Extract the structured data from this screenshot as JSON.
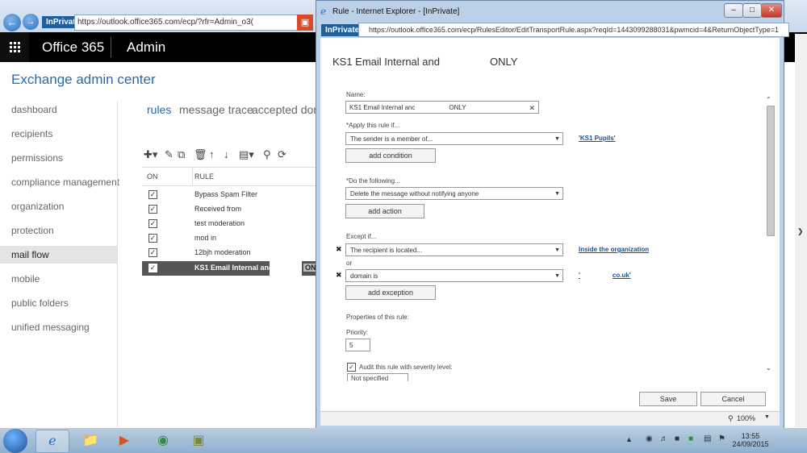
{
  "browser": {
    "inprivate": "InPrivate",
    "url": "https://outlook.office365.com/ecp/?rfr=Admin_o3("
  },
  "o365": {
    "brand": "Office 365",
    "section": "Admin"
  },
  "eac_title": "Exchange admin center",
  "nav": [
    "dashboard",
    "recipients",
    "permissions",
    "compliance management",
    "organization",
    "protection",
    "mail flow",
    "mobile",
    "public folders",
    "unified messaging"
  ],
  "tabs": [
    "rules",
    "message trace",
    "accepted dom"
  ],
  "table": {
    "headers": [
      "ON",
      "RULE"
    ],
    "rows": [
      "Bypass Spam Filter",
      "Received from",
      "test moderation",
      "mod in",
      "12bjh moderation",
      "KS1 Email Internal and"
    ],
    "selected_suffix": "ON"
  },
  "popup": {
    "title": "Rule - Internet Explorer - [InPrivate]",
    "inprivate": "InPrivate",
    "url": "https://outlook.office365.com/ecp/RulesEditor/EditTransportRule.aspx?reqId=1443099288031&pwmcid=4&ReturnObjectType=1",
    "dialog_title_a": "KS1 Email Internal and",
    "dialog_title_b": "ONLY",
    "name_label": "Name:",
    "name_value_a": "KS1 Email Internal anc",
    "name_value_b": "ONLY",
    "apply_label": "*Apply this rule if...",
    "apply_value": "The sender is a member of...",
    "apply_link": "'KS1 Pupils'",
    "add_condition": "add condition",
    "do_label": "*Do the following...",
    "do_value": "Delete the message without notifying anyone",
    "add_action": "add action",
    "except_label": "Except if...",
    "except1_value": "The recipient is located...",
    "except1_link": "Inside the organization",
    "or_label": "or",
    "except2_value": "domain is",
    "except2_link_a": "'",
    "except2_link_b": "co.uk'",
    "add_exception": "add exception",
    "props_label": "Properties of this rule:",
    "priority_label": "Priority:",
    "priority_value": "5",
    "audit_label": "Audit this rule with severity level:",
    "severity_value": "Not specified",
    "save": "Save",
    "cancel": "Cancel",
    "zoom": "100%"
  },
  "clock": {
    "time": "13:55",
    "date": "24/09/2015"
  }
}
